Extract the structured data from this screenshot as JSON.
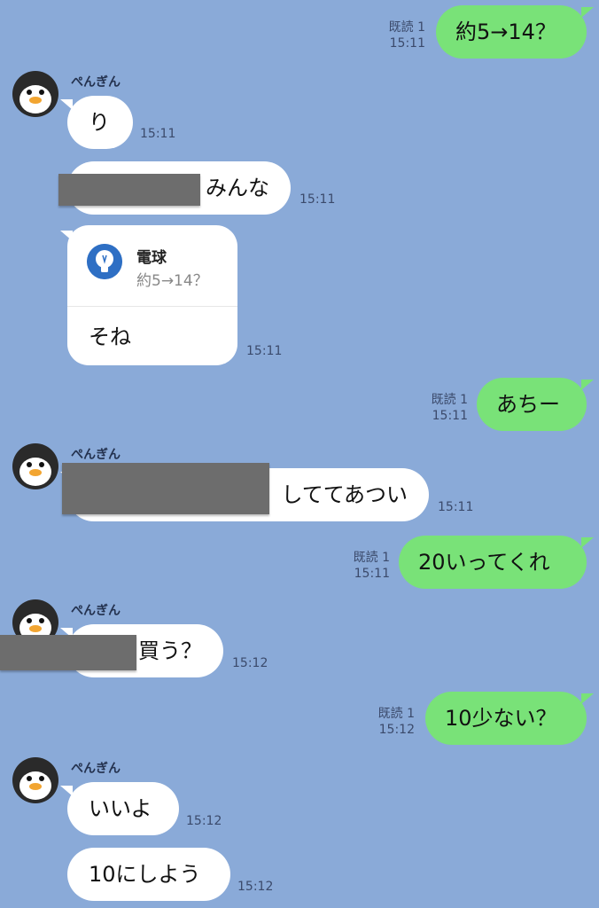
{
  "contact": {
    "name": "ぺんぎん"
  },
  "messages": [
    {
      "dir": "out",
      "read": "既読 1",
      "time": "15:11",
      "text": "約5→14？"
    },
    {
      "dir": "in",
      "time": "15:11",
      "text": "り"
    },
    {
      "dir": "in",
      "time": "15:11",
      "text": "みんな",
      "redacted": true
    },
    {
      "dir": "in",
      "time": "15:11",
      "reply_to": {
        "name": "電球",
        "quote": "約5→14？"
      },
      "text": "そね"
    },
    {
      "dir": "out",
      "read": "既読 1",
      "time": "15:11",
      "text": "あちー"
    },
    {
      "dir": "in",
      "time": "15:11",
      "text": "しててあつい",
      "redacted": true
    },
    {
      "dir": "out",
      "read": "既読 1",
      "time": "15:11",
      "text": "20いってくれ"
    },
    {
      "dir": "in",
      "time": "15:12",
      "text": "買う？",
      "redacted": true
    },
    {
      "dir": "out",
      "read": "既読 1",
      "time": "15:12",
      "text": "10少ない？"
    },
    {
      "dir": "in",
      "time": "15:12",
      "text": "いいよ"
    },
    {
      "dir": "in",
      "time": "15:12",
      "text": "10にしよう"
    }
  ],
  "colors": {
    "background": "#8aaad8",
    "outgoing": "#79e278",
    "incoming": "#ffffff",
    "redaction": "#6d6d6d"
  }
}
